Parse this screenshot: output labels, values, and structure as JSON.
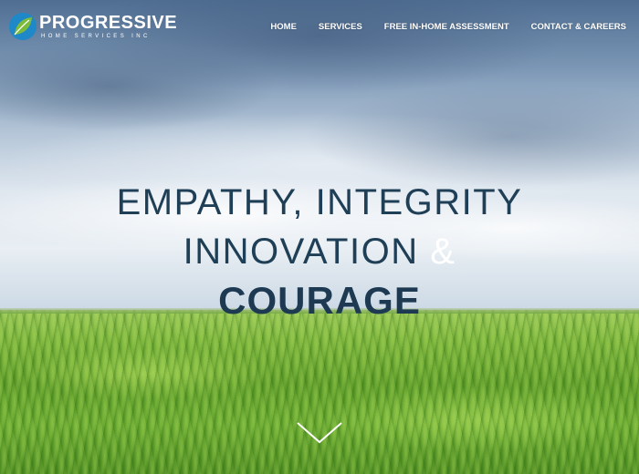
{
  "logo": {
    "name": "PROGRESSIVE",
    "subtitle": "HOME SERVICES INC"
  },
  "nav": {
    "items": [
      {
        "label": "HOME"
      },
      {
        "label": "SERVICES"
      },
      {
        "label": "FREE IN-HOME ASSESSMENT"
      },
      {
        "label": "CONTACT & CAREERS"
      }
    ]
  },
  "hero": {
    "line1": "EMPATHY, INTEGRITY",
    "line2_text": "INNOVATION",
    "line2_amp": "&",
    "line3": "COURAGE"
  },
  "colors": {
    "headline": "#1f3f57",
    "logo_blue": "#1e88c9",
    "logo_green": "#7dbb3c"
  },
  "icons": {
    "logo_mark": "leaf-circle-icon",
    "scroll": "chevron-down-icon"
  }
}
